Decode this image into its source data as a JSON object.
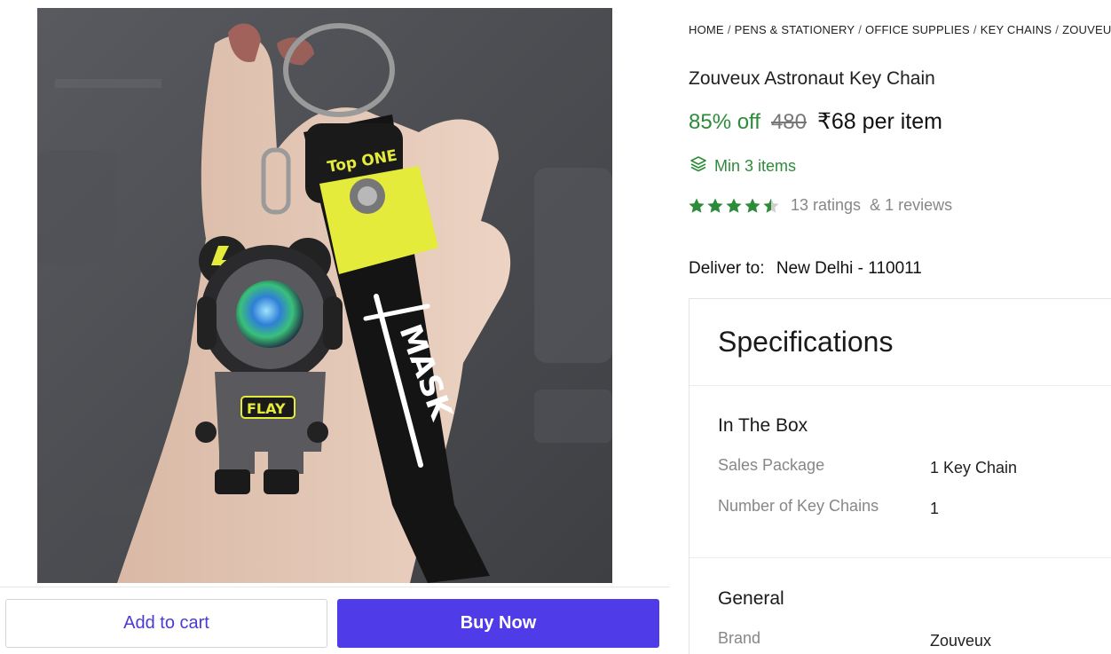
{
  "breadcrumb": [
    "HOME",
    "PENS & STATIONERY",
    "OFFICE SUPPLIES",
    "KEY CHAINS",
    "ZOUVEUX"
  ],
  "product": {
    "title": "Zouveux Astronaut Key Chain",
    "discount": "85% off",
    "mrp": "480",
    "price": "₹68 per item",
    "min_order": "Min 3 items",
    "rating_value": 4.5,
    "ratings_text": "13 ratings",
    "reviews_text": "& 1 reviews",
    "image_texts": {
      "tag": "Top ONE",
      "strap": "MASK",
      "badge": "FLAY"
    }
  },
  "delivery": {
    "label": "Deliver to:",
    "location": "New Delhi - 110011"
  },
  "specifications": {
    "title": "Specifications",
    "sections": [
      {
        "title": "In The Box",
        "rows": [
          {
            "key": "Sales Package",
            "value": "1 Key Chain"
          },
          {
            "key": "Number of Key Chains",
            "value": "1"
          }
        ]
      },
      {
        "title": "General",
        "rows": [
          {
            "key": "Brand",
            "value": "Zouveux"
          }
        ]
      }
    ]
  },
  "actions": {
    "add_to_cart": "Add to cart",
    "buy_now": "Buy Now"
  },
  "colors": {
    "accent": "#4f3ce8",
    "green": "#2e8b3a",
    "star": "#2e8b3a"
  },
  "icons": {
    "min_order": "layers-icon",
    "rating": "star-icon"
  }
}
